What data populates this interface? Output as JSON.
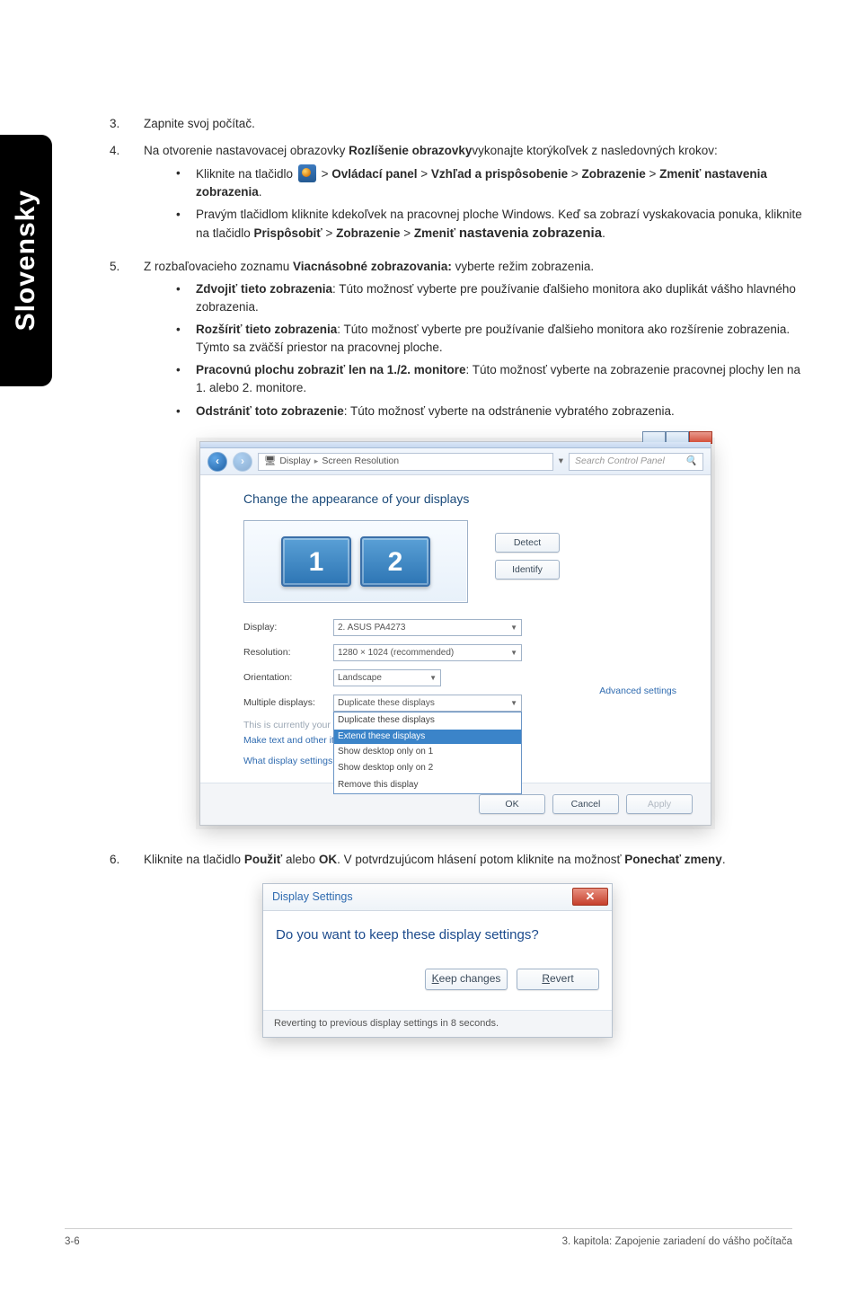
{
  "sideTab": "Slovensky",
  "steps": {
    "s3": {
      "num": "3.",
      "text": "Zapnite svoj počítač."
    },
    "s4": {
      "num": "4.",
      "intro_a": "Na otvorenie nastavovacej obrazovky ",
      "intro_b": "Rozlíšenie obrazovky",
      "intro_c": "vykonajte ktorýkoľvek z nasledovných krokov:",
      "b1": {
        "pre": "Kliknite na tlačidlo ",
        "p1": "Ovládací panel",
        "p2": "Vzhľad a prispôsobenie",
        "p3": "Zobrazenie",
        "p4": "Zmeniť nastavenia zobrazenia",
        "dot": "."
      },
      "b2": {
        "l1": "Pravým tlačidlom kliknite kdekoľvek na pracovnej ploche Windows. Keď sa zobrazí vyskakovacia ponuka, kliknite na tlačidlo ",
        "p1": "Prispôsobiť",
        "p2": "Zobrazenie",
        "p3": "Zmeniť",
        "p4": "nastavenia zobrazenia",
        "dot": "."
      }
    },
    "s5": {
      "num": "5.",
      "intro_a": "Z rozbaľovacieho zoznamu ",
      "intro_b": "Viacnásobné zobrazovania:",
      "intro_c": " vyberte režim zobrazenia.",
      "i1": {
        "t": "Zdvojiť tieto zobrazenia",
        "d": ": Túto možnosť vyberte pre používanie ďalšieho monitora ako duplikát vášho hlavného zobrazenia."
      },
      "i2": {
        "t": "Rozšíriť tieto zobrazenia",
        "d": ": Túto možnosť vyberte pre používanie ďalšieho monitora ako rozšírenie zobrazenia. Týmto sa zväčší priestor na pracovnej ploche."
      },
      "i3": {
        "t": "Pracovnú plochu zobraziť len na 1./2. monitore",
        "d": ": Túto možnosť vyberte na zobrazenie pracovnej plochy len na 1. alebo 2. monitore."
      },
      "i4": {
        "t": "Odstrániť toto zobrazenie",
        "d": ": Túto možnosť vyberte na odstránenie vybratého zobrazenia."
      }
    },
    "s6": {
      "num": "6.",
      "a": "Kliknite na tlačidlo ",
      "b": "Použiť",
      "c": " alebo ",
      "d": "OK",
      "e": ". V potvrdzujúcom hlásení potom kliknite na možnosť ",
      "f": "Ponechať zmeny",
      "g": "."
    }
  },
  "shot1": {
    "breadcrumb_icon": "🖥",
    "breadcrumb1": "Display",
    "breadcrumb2": "Screen Resolution",
    "search_ph": "Search Control Panel",
    "heading": "Change the appearance of your displays",
    "mon1": "1",
    "mon2": "2",
    "btnDetect": "Detect",
    "btnIdentify": "Identify",
    "lblDisplay": "Display:",
    "valDisplay": "2. ASUS PA4273",
    "lblRes": "Resolution:",
    "valRes": "1280 × 1024 (recommended)",
    "lblOrient": "Orientation:",
    "valOrient": "Landscape",
    "lblMulti": "Multiple displays:",
    "valMulti": "Duplicate these displays",
    "ddOpt1": "Duplicate these displays",
    "ddOpt2": "Extend these displays",
    "ddOpt3": "Show desktop only on 1",
    "ddOpt4": "Show desktop only on 2",
    "ddOpt5": "Remove this display",
    "noteMain": "This is currently your main display.",
    "noteAdv": "Advanced settings",
    "link1": "Make text and other items larger or smaller",
    "link2": "What display settings should I choose?",
    "btnOK": "OK",
    "btnCancel": "Cancel",
    "btnApply": "Apply"
  },
  "shot2": {
    "title": "Display Settings",
    "question": "Do you want to keep these display settings?",
    "keep": "Keep changes",
    "revert": "Revert",
    "footer": "Reverting to previous display settings in 8 seconds."
  },
  "footer": {
    "left": "3-6",
    "right": "3. kapitola: Zapojenie zariadení do vášho počítača"
  }
}
